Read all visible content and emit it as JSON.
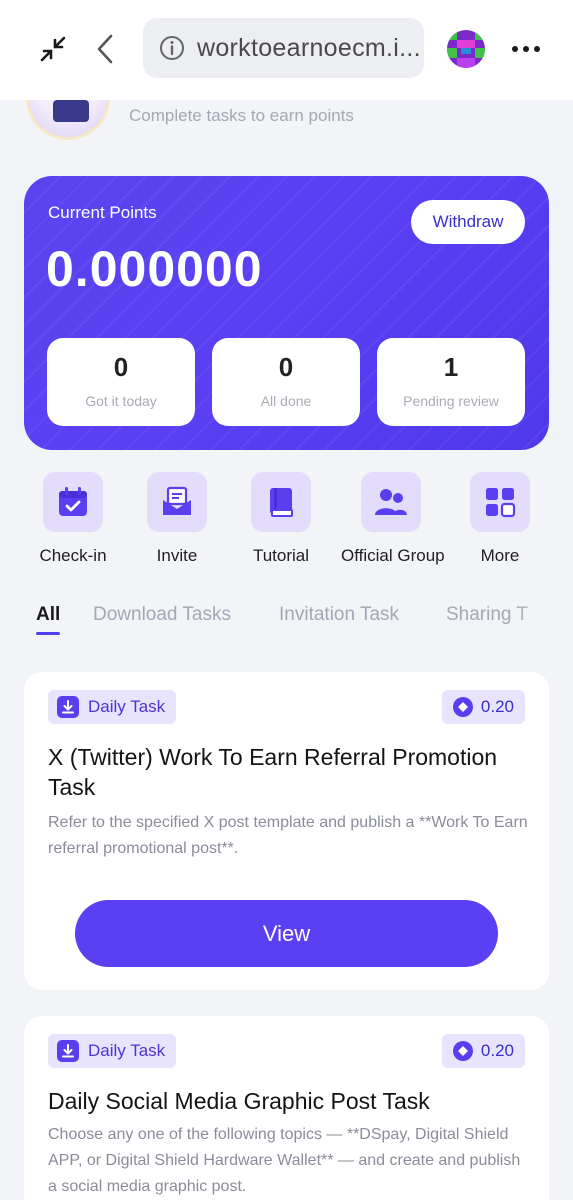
{
  "browser": {
    "url": "worktoearnoecm.i...",
    "icons": [
      "shrink-icon",
      "back-arrow-icon",
      "info-icon",
      "avatar",
      "more-dots-icon"
    ]
  },
  "header": {
    "subtitle": "Complete tasks to earn points"
  },
  "points": {
    "label": "Current Points",
    "value": "0.000000",
    "withdraw_label": "Withdraw",
    "stats": [
      {
        "value": "0",
        "label": "Got it today"
      },
      {
        "value": "0",
        "label": "All done"
      },
      {
        "value": "1",
        "label": "Pending review"
      }
    ]
  },
  "quick_actions": [
    {
      "label": "Check-in",
      "icon": "calendar-check-icon"
    },
    {
      "label": "Invite",
      "icon": "envelope-icon"
    },
    {
      "label": "Tutorial",
      "icon": "book-icon"
    },
    {
      "label": "Official Group",
      "icon": "group-icon"
    },
    {
      "label": "More",
      "icon": "grid-icon"
    }
  ],
  "tabs": [
    {
      "label": "All",
      "active": true
    },
    {
      "label": "Download Tasks",
      "active": false
    },
    {
      "label": "Invitation Task",
      "active": false
    },
    {
      "label": "Sharing T",
      "active": false
    }
  ],
  "tasks": [
    {
      "badge": "Daily Task",
      "reward": "0.20",
      "title": "X (Twitter) Work To Earn Referral Promotion Task",
      "description": "Refer to the specified X post template and publish a **Work To Earn referral promotional post**.",
      "button": "View"
    },
    {
      "badge": "Daily Task",
      "reward": "0.20",
      "title": "Daily Social Media Graphic Post Task",
      "description": "Choose any one of the following topics — **DSpay, Digital Shield APP, or Digital Shield Hardware Wallet** — and create and publish a social media graphic post."
    }
  ],
  "colors": {
    "accent": "#5b3ff2",
    "card_gradient_start": "#5b44ee",
    "background": "#f3f4f8",
    "badge_bg": "#e8e4fd"
  }
}
